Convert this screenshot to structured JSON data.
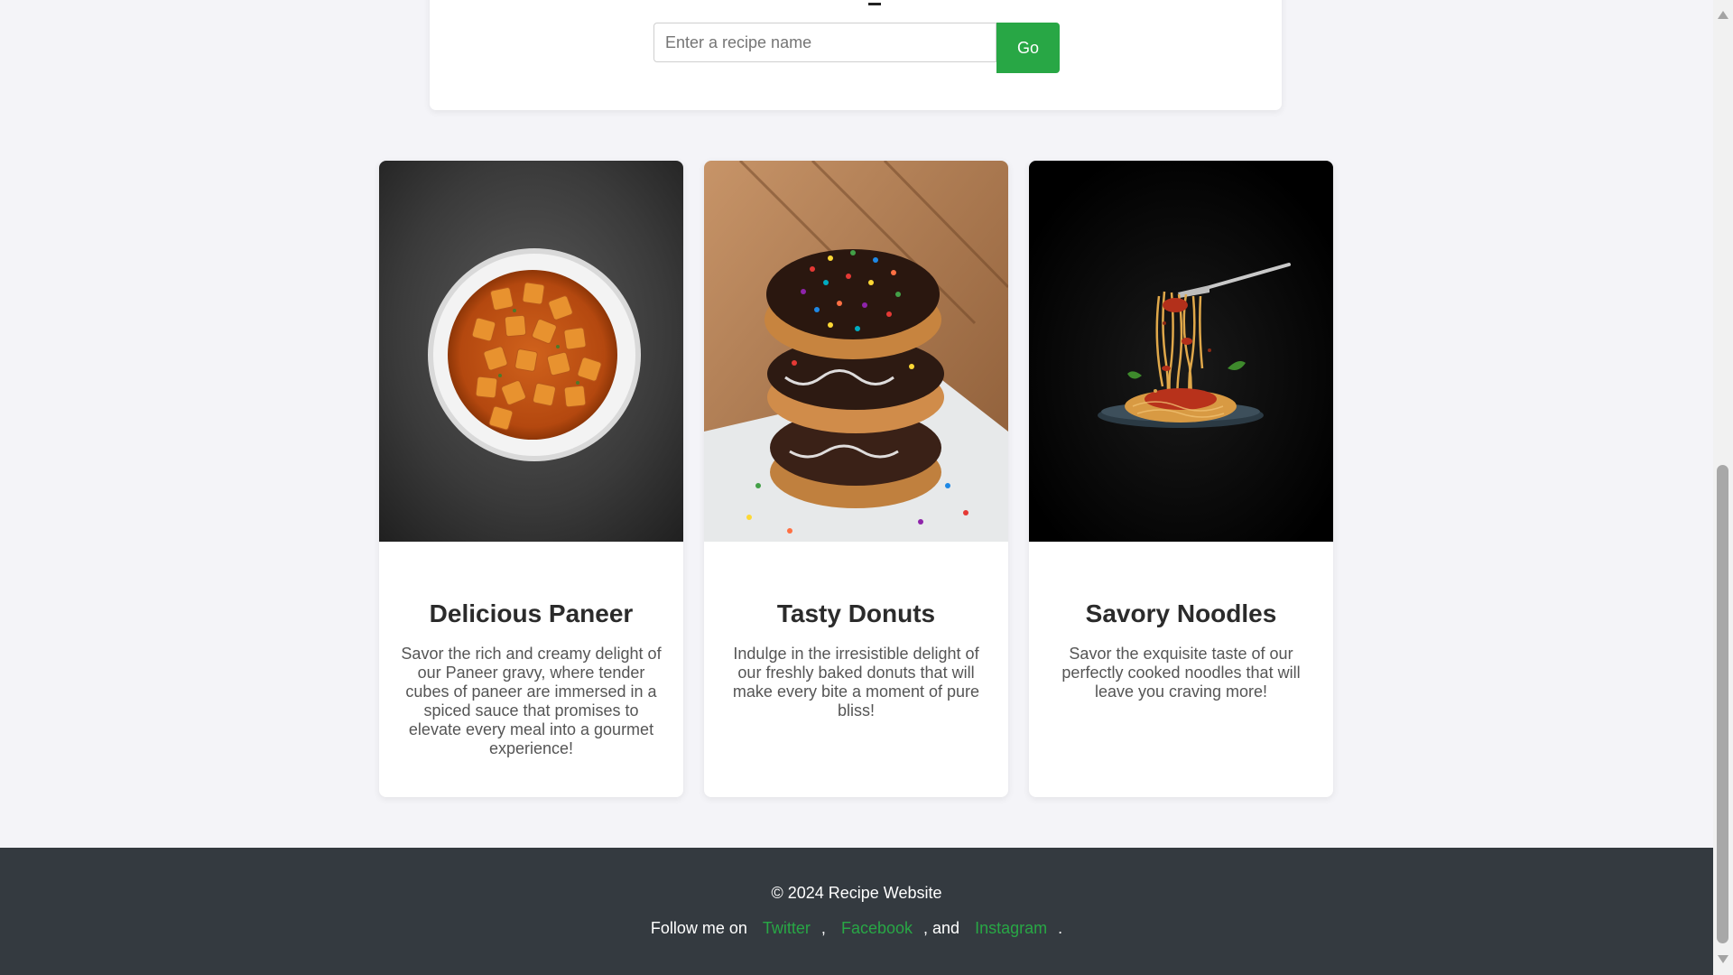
{
  "search": {
    "placeholder": "Enter a recipe name",
    "button_label": "Go"
  },
  "recipes": [
    {
      "title": "Delicious Paneer",
      "description": "Savor the rich and creamy delight of our Paneer gravy, where tender cubes of paneer are immersed in a spiced sauce that promises to elevate every meal into a gourmet experience!"
    },
    {
      "title": "Tasty Donuts",
      "description": "Indulge in the irresistible delight of our freshly baked donuts that will make every bite a moment of pure bliss!"
    },
    {
      "title": "Savory Noodles",
      "description": "Savor the exquisite taste of our perfectly cooked noodles that will leave you craving more!"
    }
  ],
  "footer": {
    "copyright": "© 2024 Recipe Website",
    "follow_prefix": "Follow me on",
    "links": [
      "Twitter",
      "Facebook",
      "Instagram"
    ],
    "sep1": ",",
    "sep2": ", and",
    "sep3": "."
  },
  "colors": {
    "accent": "#28a745",
    "footer_bg": "#343a40",
    "page_bg": "#f4f4f8"
  }
}
